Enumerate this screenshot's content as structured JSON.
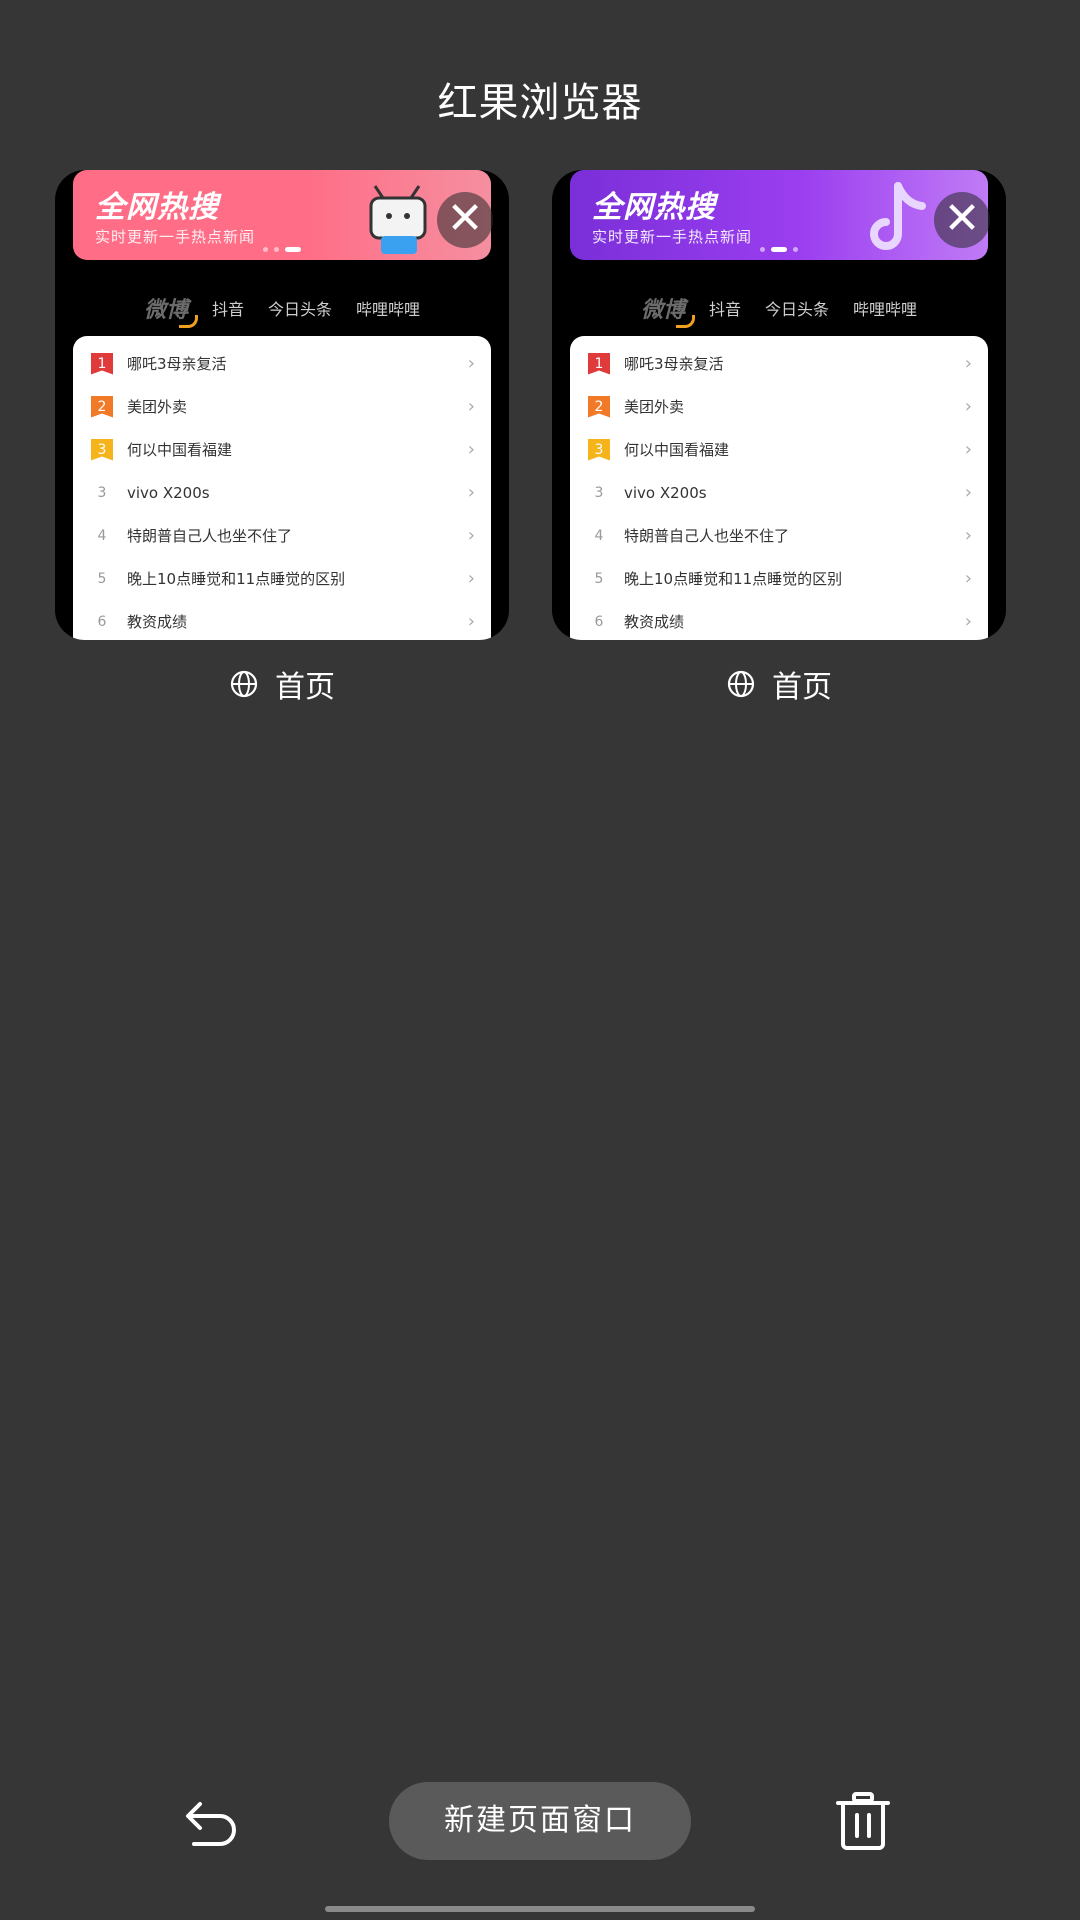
{
  "app_title": "红果浏览器",
  "tabs": [
    {
      "banner": {
        "title": "全网热搜",
        "subtitle": "实时更新一手热点新闻",
        "theme_color": "#ff6d86"
      },
      "close_icon": "close-icon",
      "sources": [
        "微博",
        "抖音",
        "今日头条",
        "哔哩哔哩"
      ],
      "hot_list": [
        {
          "rank": "1",
          "text": "哪吒3母亲复活"
        },
        {
          "rank": "2",
          "text": "美团外卖"
        },
        {
          "rank": "3",
          "text": "何以中国看福建"
        },
        {
          "rank": "3",
          "text": "vivo X200s"
        },
        {
          "rank": "4",
          "text": "特朗普自己人也坐不住了"
        },
        {
          "rank": "5",
          "text": "晚上10点睡觉和11点睡觉的区别"
        },
        {
          "rank": "6",
          "text": "教资成绩"
        }
      ],
      "label": "首页"
    },
    {
      "banner": {
        "title": "全网热搜",
        "subtitle": "实时更新一手热点新闻",
        "theme_color": "#8b35e6"
      },
      "close_icon": "close-icon",
      "sources": [
        "微博",
        "抖音",
        "今日头条",
        "哔哩哔哩"
      ],
      "hot_list": [
        {
          "rank": "1",
          "text": "哪吒3母亲复活"
        },
        {
          "rank": "2",
          "text": "美团外卖"
        },
        {
          "rank": "3",
          "text": "何以中国看福建"
        },
        {
          "rank": "3",
          "text": "vivo X200s"
        },
        {
          "rank": "4",
          "text": "特朗普自己人也坐不住了"
        },
        {
          "rank": "5",
          "text": "晚上10点睡觉和11点睡觉的区别"
        },
        {
          "rank": "6",
          "text": "教资成绩"
        }
      ],
      "label": "首页"
    }
  ],
  "bottom_bar": {
    "back_icon": "undo-icon",
    "new_window_label": "新建页面窗口",
    "trash_icon": "trash-icon"
  },
  "colors": {
    "background": "#363636",
    "button_bg": "#5a5a5a"
  }
}
